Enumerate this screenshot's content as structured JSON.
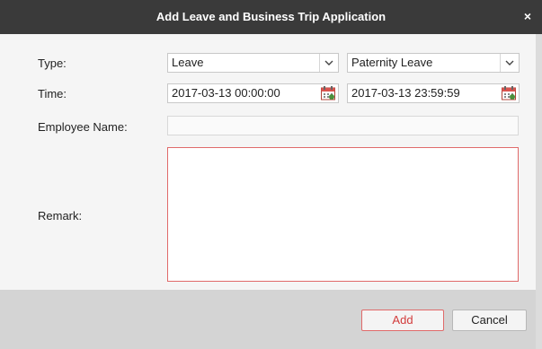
{
  "window": {
    "title": "Add Leave and Business Trip Application",
    "close_label": "×"
  },
  "form": {
    "type_label": "Type:",
    "type_value": "Leave",
    "subtype_value": "Paternity Leave",
    "time_label": "Time:",
    "start_time": "2017-03-13 00:00:00",
    "end_time": "2017-03-13 23:59:59",
    "employee_label": "Employee Name:",
    "employee_value": "",
    "remark_label": "Remark:",
    "remark_value": ""
  },
  "footer": {
    "add_label": "Add",
    "cancel_label": "Cancel"
  },
  "colors": {
    "titlebar": "#3a3a3a",
    "accent_red": "#e06a6a",
    "footer": "#d4d4d4"
  },
  "icons": {
    "type_dropdown": "chevron-down-icon",
    "subtype_dropdown": "chevron-down-icon",
    "start_picker": "calendar-icon",
    "end_picker": "calendar-icon",
    "close": "close-icon"
  }
}
